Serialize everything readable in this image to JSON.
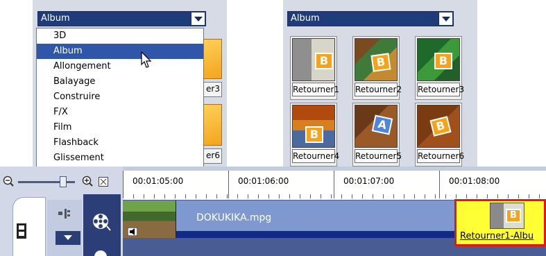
{
  "library_left": {
    "category": "Album",
    "dropdown_items": [
      "3D",
      "Album",
      "Allongement",
      "Balayage",
      "Construire",
      "F/X",
      "Film",
      "Flashback",
      "Glissement"
    ],
    "selected_index": 1,
    "partial_labels": [
      "er3",
      "er6"
    ]
  },
  "library_right": {
    "category": "Album",
    "thumbnails": [
      "Retourner1",
      "Retourner2",
      "Retourner3",
      "Retourner4",
      "Retourner5",
      "Retourner6"
    ]
  },
  "timeline": {
    "timecodes": [
      "00:01:05:00",
      "00:01:06:00",
      "00:01:07:00",
      "00:01:08:00"
    ],
    "clip_name": "DOKUKIKA.mpg",
    "transition_label": "Retourner1-Albu",
    "tile_letter": "B"
  },
  "icons": {
    "zoom_out": "zoom-out-icon",
    "zoom_in": "zoom-in-icon",
    "fit": "fit-project-icon",
    "storyboard": "film-strip-icon",
    "video_track": "film-reel-icon"
  },
  "colors": {
    "selection": "#2f56a8",
    "transition_border": "#e01818",
    "transition_fill": "#ffff33"
  }
}
